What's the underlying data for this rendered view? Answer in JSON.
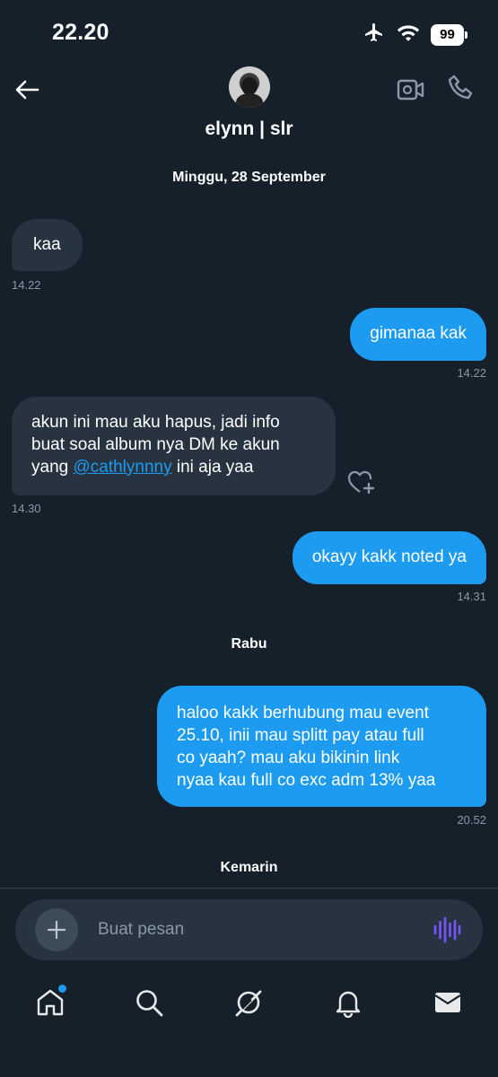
{
  "status": {
    "time": "22.20",
    "battery": "99"
  },
  "header": {
    "contact_name": "elynn | slr"
  },
  "messages": [
    {
      "type": "date",
      "text": "Minggu, 28 September"
    },
    {
      "dir": "in",
      "text": "kaa",
      "time": "14.22"
    },
    {
      "dir": "out",
      "text": "gimanaa kak",
      "time": "14.22"
    },
    {
      "dir": "in",
      "line1": "akun ini mau aku hapus, jadi info",
      "line2": "buat soal album nya DM ke akun",
      "line3_pre": "yang ",
      "mention": "@cathlynnny",
      "line3_post": " ini aja yaa",
      "time": "14.30"
    },
    {
      "dir": "out",
      "text": "okayy kakk noted ya",
      "time": "14.31"
    },
    {
      "type": "date",
      "text": "Rabu"
    },
    {
      "dir": "out",
      "line1": "haloo kakk berhubung mau event",
      "line2": "25.10, inii mau splitt pay atau full",
      "line3": "co yaah? mau aku bikinin link",
      "line4": "nyaa kau full co exc adm 13% yaa",
      "time": "20.52"
    },
    {
      "type": "date",
      "text": "Kemarin"
    }
  ],
  "composer": {
    "placeholder": "Buat pesan"
  },
  "colors": {
    "background": "#15202b",
    "bubble_in": "#273340",
    "bubble_out": "#1d9bf0",
    "voice_accent": "#7856ff"
  },
  "nav": {
    "items": [
      "home-icon",
      "search-icon",
      "grok-icon",
      "bell-icon",
      "mail-icon"
    ],
    "active": "mail-icon"
  }
}
